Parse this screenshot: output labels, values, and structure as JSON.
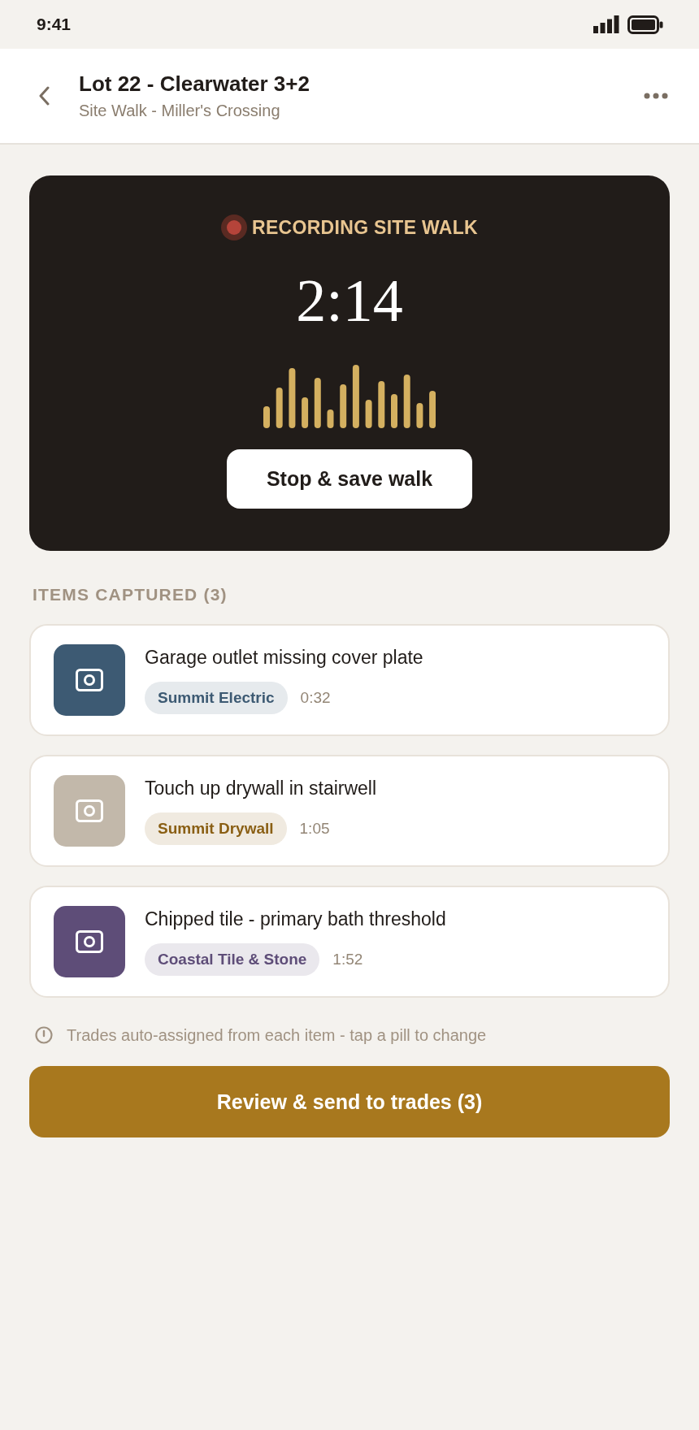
{
  "status_bar": {
    "time": "9:41"
  },
  "header": {
    "title": "Lot 22 - Clearwater 3+2",
    "subtitle": "Site Walk - Miller's Crossing"
  },
  "recording": {
    "label": "RECORDING SITE WALK",
    "elapsed": "2:14",
    "stop_button": "Stop & save walk"
  },
  "items_section": {
    "heading": "ITEMS CAPTURED (3)",
    "items": [
      {
        "title": "Garage outlet missing cover plate",
        "color": "#3d5a73",
        "trade": {
          "label": "Summit Electric",
          "color": "#3d5a73"
        },
        "time": "0:32"
      },
      {
        "title": "Touch up drywall in stairwell",
        "color": "#c2b8aa",
        "trade": {
          "label": "Summit Drywall",
          "color": "#8a5f14"
        },
        "time": "1:05"
      },
      {
        "title": "Chipped tile - primary bath threshold",
        "color": "#5e4d78",
        "trade": {
          "label": "Coastal Tile & Stone",
          "color": "#5e4d78"
        },
        "time": "1:52"
      }
    ]
  },
  "hint": "Trades auto-assigned from each item - tap a pill to change",
  "primary_button": "Review & send to trades (3)"
}
